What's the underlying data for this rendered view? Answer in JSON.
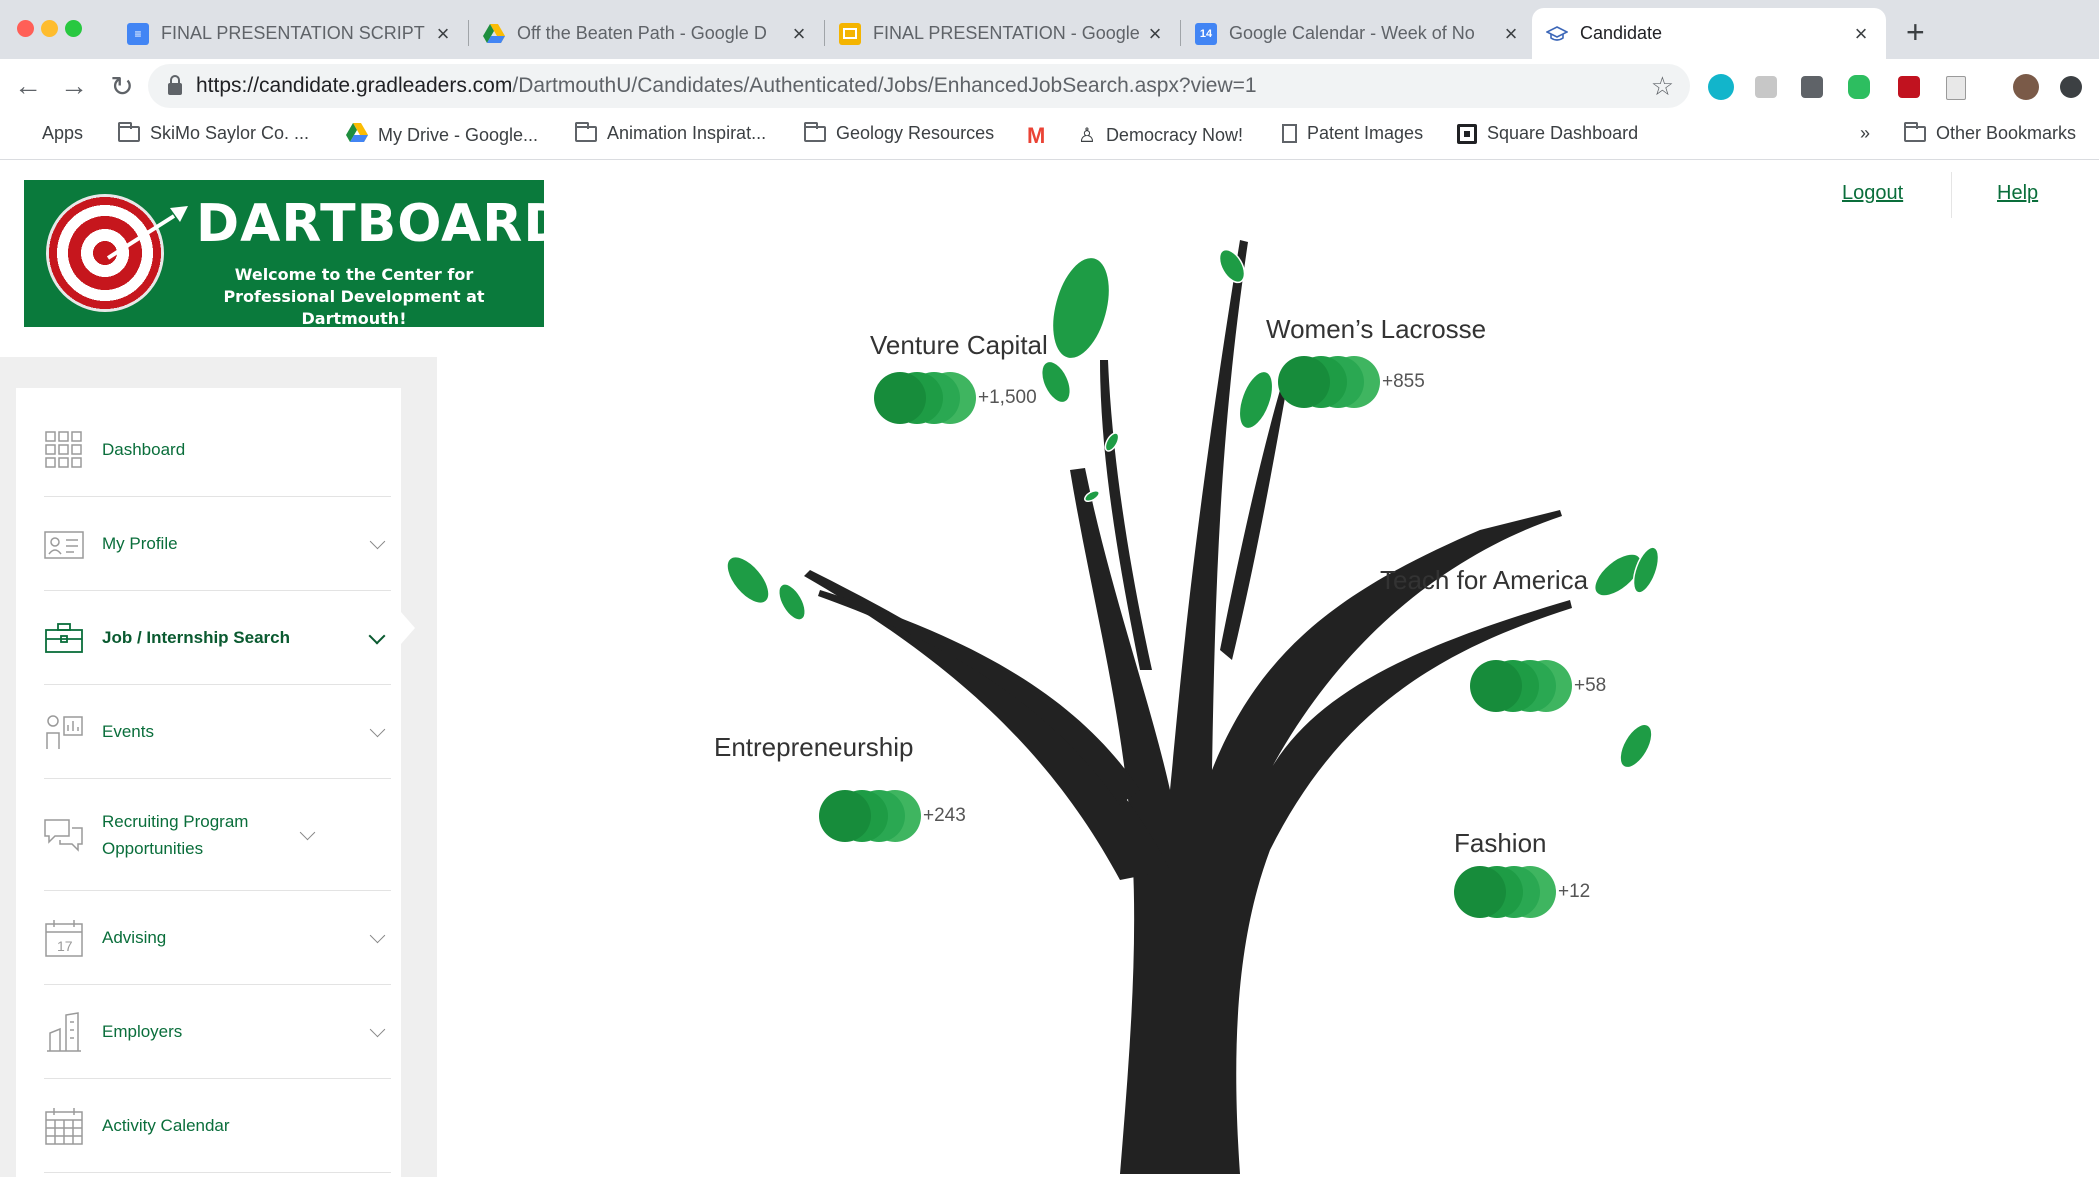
{
  "browser": {
    "tabs": [
      {
        "title": "FINAL PRESENTATION SCRIPT",
        "icon": "google-docs-icon",
        "color": "#4285f4"
      },
      {
        "title": "Off the Beaten Path - Google D",
        "icon": "google-drive-icon",
        "color": "#fbbc04"
      },
      {
        "title": "FINAL PRESENTATION - Google",
        "icon": "google-slides-icon",
        "color": "#f4b400"
      },
      {
        "title": "Google Calendar - Week of No",
        "icon": "google-calendar-icon",
        "color": "#4285f4"
      },
      {
        "title": "Candidate",
        "icon": "graduation-cap-icon",
        "color": "#5f6368"
      }
    ],
    "url_host": "https://candidate.gradleaders.com",
    "url_path": "/DartmouthU/Candidates/Authenticated/Jobs/EnhancedJobSearch.aspx?view=1",
    "bookmarks": [
      {
        "label": "Apps",
        "icon": "apps-grid-icon"
      },
      {
        "label": "SkiMo Saylor Co. ...",
        "icon": "folder-icon"
      },
      {
        "label": "My Drive - Google...",
        "icon": "google-drive-icon"
      },
      {
        "label": "Animation Inspirat...",
        "icon": "folder-icon"
      },
      {
        "label": "Geology Resources",
        "icon": "folder-icon"
      },
      {
        "label": "",
        "icon": "gmail-icon"
      },
      {
        "label": "Democracy Now!",
        "icon": "statue-icon"
      },
      {
        "label": "Patent Images",
        "icon": "page-icon"
      },
      {
        "label": "Square Dashboard",
        "icon": "square-icon"
      }
    ],
    "bookmarks_overflow": "»",
    "other_bookmarks": "Other Bookmarks"
  },
  "header": {
    "logo_title": "DARTBOARD",
    "logo_subtitle": "Welcome to the Center for Professional Development at Dartmouth!",
    "logout": "Logout",
    "help": "Help"
  },
  "sidebar": {
    "items": [
      {
        "label": "Dashboard",
        "icon": "grid-icon",
        "expandable": false,
        "active": false
      },
      {
        "label": "My Profile",
        "icon": "profile-card-icon",
        "expandable": true,
        "active": false
      },
      {
        "label": "Job / Internship Search",
        "icon": "briefcase-icon",
        "expandable": true,
        "active": true
      },
      {
        "label": "Events",
        "icon": "events-icon",
        "expandable": true,
        "active": false
      },
      {
        "label": "Recruiting Program Opportunities",
        "icon": "chat-bubbles-icon",
        "expandable": true,
        "active": false
      },
      {
        "label": "Advising",
        "icon": "calendar-17-icon",
        "expandable": true,
        "active": false
      },
      {
        "label": "Employers",
        "icon": "building-icon",
        "expandable": true,
        "active": false
      },
      {
        "label": "Activity Calendar",
        "icon": "calendar-grid-icon",
        "expandable": false,
        "active": false
      }
    ]
  },
  "career_tree": {
    "accent": "#1e9c45",
    "branches": [
      {
        "title": "Venture Capital",
        "count": "+1,500"
      },
      {
        "title": "Women’s Lacrosse",
        "count": "+855"
      },
      {
        "title": "Teach for America",
        "count": "+58"
      },
      {
        "title": "Entrepreneurship",
        "count": "+243"
      },
      {
        "title": "Fashion",
        "count": "+12"
      }
    ]
  }
}
